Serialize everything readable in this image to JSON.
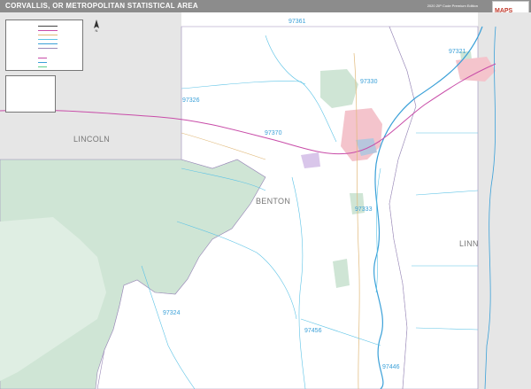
{
  "header": {
    "title": "CORVALLIS, OR METROPOLITAN STATISTICAL AREA",
    "edition": "2020 ZIP Code Premium Edition",
    "logo_text": "MAPS"
  },
  "counties": [
    {
      "id": "lincoln",
      "name": "LINCOLN"
    },
    {
      "id": "benton",
      "name": "BENTON"
    },
    {
      "id": "linn",
      "name": "LINN"
    }
  ],
  "zip_codes": [
    {
      "id": "z97361",
      "code": "97361"
    },
    {
      "id": "z97321",
      "code": "97321"
    },
    {
      "id": "z97326",
      "code": "97326"
    },
    {
      "id": "z97330",
      "code": "97330"
    },
    {
      "id": "z97370",
      "code": "97370"
    },
    {
      "id": "z97333",
      "code": "97333"
    },
    {
      "id": "z97324",
      "code": "97324"
    },
    {
      "id": "z97456",
      "code": "97456"
    },
    {
      "id": "z97446",
      "code": "97446"
    }
  ],
  "colors": {
    "title_bar": "#8c8c8c",
    "outside_area": "#e6e6e6",
    "forest": "#cfe5d5",
    "urban": "#f4c4cc",
    "zip_boundary": "#5cc3e6",
    "county_boundary": "#9a8ab8",
    "highway": "#c84ca8",
    "road": "#e0b878",
    "river": "#3aa0d8",
    "county_label": "#777777",
    "zip_label": "#3aa0d8"
  },
  "icons": {
    "compass": "north-arrow-icon",
    "logo": "market-maps-logo"
  }
}
